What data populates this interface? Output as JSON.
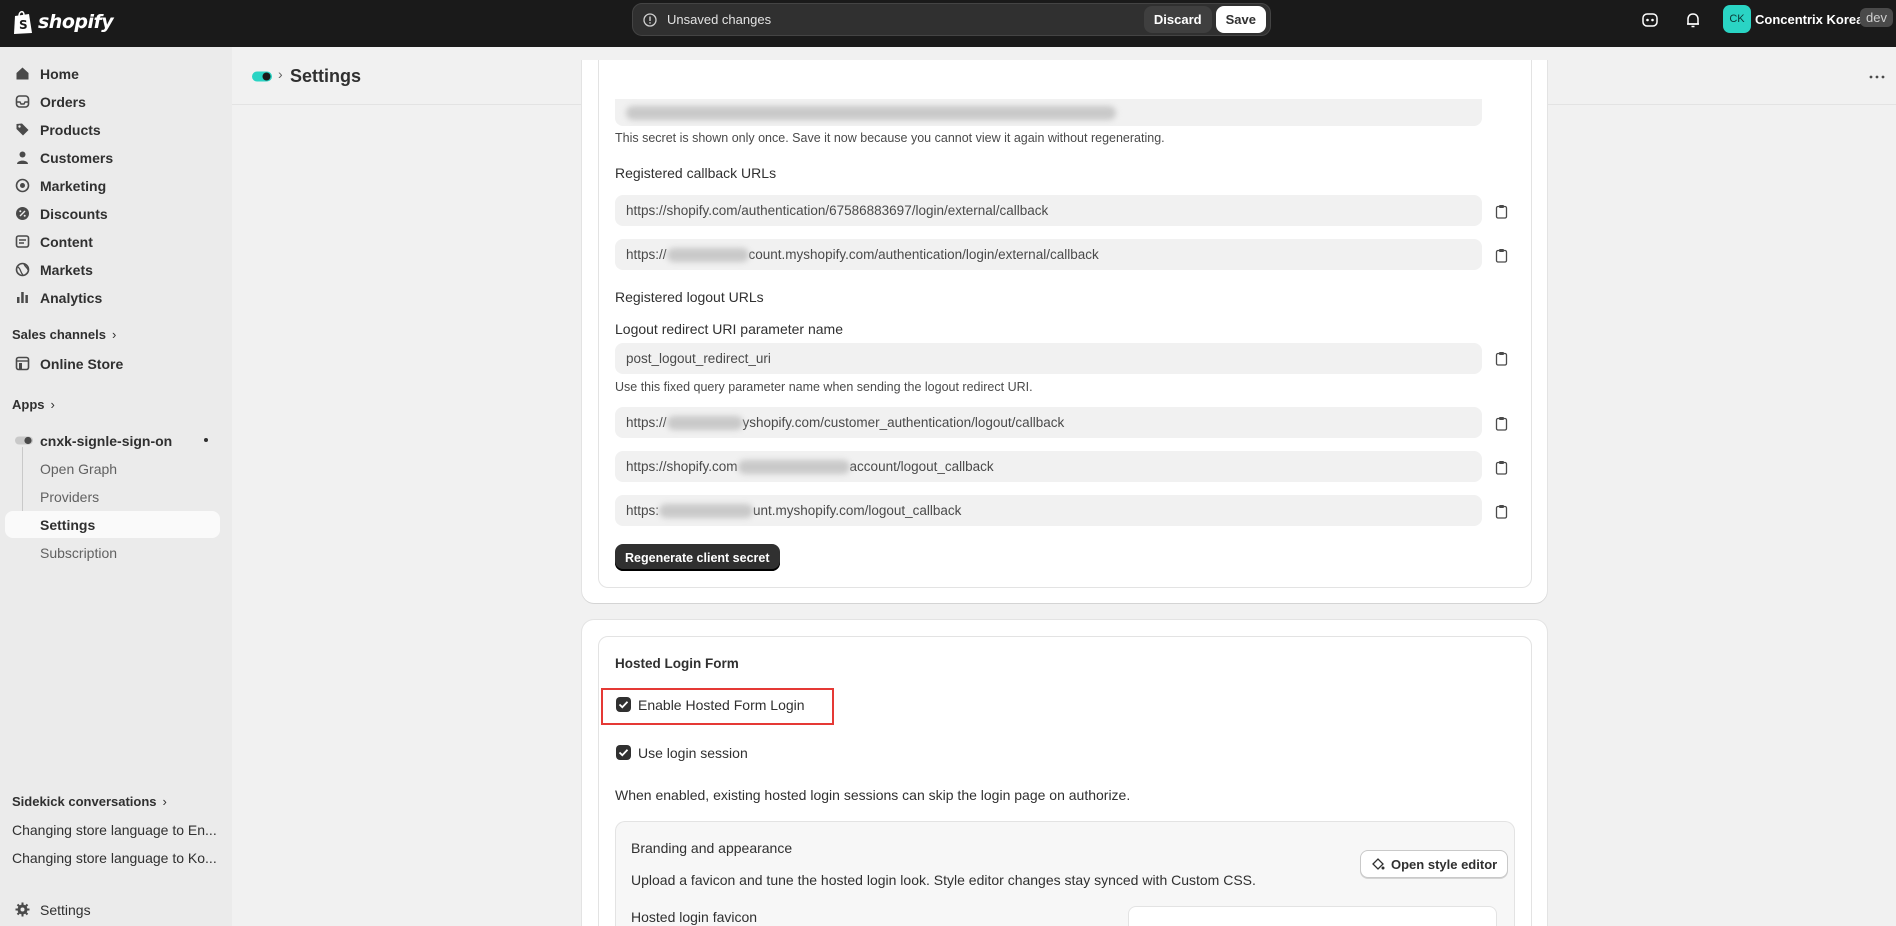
{
  "topbar": {
    "logo_text": "shopify",
    "unsaved_message": "Unsaved changes",
    "discard_label": "Discard",
    "save_label": "Save",
    "avatar_initials": "CK",
    "store_name": "Concentrix Korea",
    "env_badge": "dev"
  },
  "sidebar": {
    "items": [
      {
        "label": "Home",
        "icon": "home-icon"
      },
      {
        "label": "Orders",
        "icon": "inbox-icon"
      },
      {
        "label": "Products",
        "icon": "tag-icon"
      },
      {
        "label": "Customers",
        "icon": "person-icon"
      },
      {
        "label": "Marketing",
        "icon": "target-icon"
      },
      {
        "label": "Discounts",
        "icon": "discount-icon"
      },
      {
        "label": "Content",
        "icon": "content-icon"
      },
      {
        "label": "Markets",
        "icon": "globe-icon"
      },
      {
        "label": "Analytics",
        "icon": "bar-chart-icon"
      }
    ],
    "sales_channels_label": "Sales channels",
    "online_store_label": "Online Store",
    "apps_label": "Apps",
    "app_name": "cnxk-signle-sign-on",
    "app_subitems": [
      "Open Graph",
      "Providers",
      "Settings",
      "Subscription"
    ],
    "sidekick_label": "Sidekick conversations",
    "sidekick_items": [
      "Changing store language to En...",
      "Changing store language to Ko..."
    ],
    "settings_label": "Settings"
  },
  "header": {
    "title": "Settings"
  },
  "credentials": {
    "secret_help": "This secret is shown only once. Save it now because you cannot view it again without regenerating.",
    "callback_label": "Registered callback URLs",
    "callback_urls": [
      {
        "prefix": "https://shopify.com/authentication/67586883697/login/external/callback",
        "suffix": ""
      },
      {
        "prefix": "https://",
        "suffix": "count.myshopify.com/authentication/login/external/callback"
      }
    ],
    "logout_label": "Registered logout URLs",
    "logout_param_label": "Logout redirect URI parameter name",
    "logout_param_value": "post_logout_redirect_uri",
    "logout_param_help": "Use this fixed query parameter name when sending the logout redirect URI.",
    "logout_urls": [
      {
        "prefix": "https://",
        "suffix": "yshopify.com/customer_authentication/logout/callback"
      },
      {
        "prefix": "https://shopify.com",
        "suffix": "account/logout_callback"
      },
      {
        "prefix": "https:",
        "suffix": "unt.myshopify.com/logout_callback"
      }
    ],
    "regenerate_label": "Regenerate client secret"
  },
  "hosted_login": {
    "title": "Hosted Login Form",
    "enable_label": "Enable Hosted Form Login",
    "enable_checked": true,
    "session_label": "Use login session",
    "session_checked": true,
    "session_help": "When enabled, existing hosted login sessions can skip the login page on authorize.",
    "branding_title": "Branding and appearance",
    "branding_desc": "Upload a favicon and tune the hosted login look. Style editor changes stay synced with Custom CSS.",
    "style_editor_label": "Open style editor",
    "favicon_label": "Hosted login favicon"
  },
  "colors": {
    "topbar_bg": "#1a1a1a",
    "accent_teal": "#2ad4c4",
    "highlight_red": "#e53935"
  }
}
